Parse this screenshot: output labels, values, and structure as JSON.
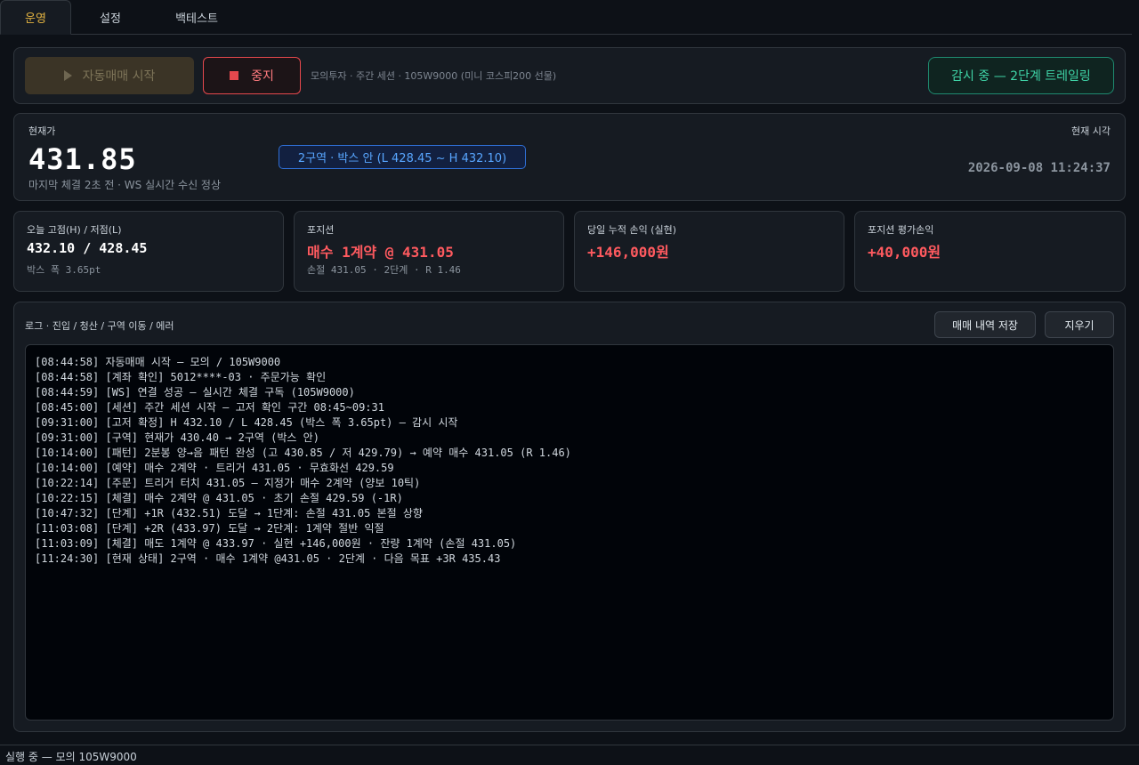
{
  "tabs": [
    {
      "label": "운영"
    },
    {
      "label": "설정"
    },
    {
      "label": "백테스트"
    }
  ],
  "controls": {
    "start_label": "자동매매 시작",
    "stop_label": "중지",
    "session_info": "모의투자 · 주간 세션 · 105W9000 (미니 코스피200 선물)",
    "status_label": "감시 중 — 2단계 트레일링"
  },
  "price": {
    "label": "현재가",
    "value": "431.85",
    "subinfo": "마지막 체결 2초 전 · WS 실시간 수신 정상",
    "zone_badge": "2구역 · 박스 안 (L 428.45 ~ H 432.10)",
    "clock_label": "현재 시각",
    "clock_value": "2026-09-08  11:24:37"
  },
  "cards": [
    {
      "title": "오늘 고점(H) / 저점(L)",
      "value": "432.10 / 428.45",
      "sub": "박스 폭 3.65pt",
      "color": "#ffffff"
    },
    {
      "title": "포지션",
      "value": "매수 1계약 @ 431.05",
      "sub": "손절 431.05 · 2단계 · R 1.46",
      "color": "#ff5a5f"
    },
    {
      "title": "당일 누적 손익 (실현)",
      "value": "+146,000원",
      "sub": "",
      "color": "#ff5a5f"
    },
    {
      "title": "포지션 평가손익",
      "value": "+40,000원",
      "sub": "",
      "color": "#ff5a5f"
    }
  ],
  "log": {
    "header": "로그 · 진입 / 청산 / 구역 이동 / 에러",
    "save_label": "매매 내역 저장",
    "clear_label": "지우기",
    "lines": [
      "[08:44:58] 자동매매 시작 — 모의 / 105W9000",
      "[08:44:58] [계좌 확인] 5012****-03 · 주문가능 확인",
      "[08:44:59] [WS] 연결 성공 — 실시간 체결 구독 (105W9000)",
      "[08:45:00] [세션] 주간 세션 시작 — 고저 확인 구간 08:45~09:31",
      "[09:31:00] [고저 확정] H 432.10 / L 428.45 (박스 폭 3.65pt) — 감시 시작",
      "[09:31:00] [구역] 현재가 430.40 → 2구역 (박스 안)",
      "[10:14:00] [패턴] 2분봉 양→음 패턴 완성 (고 430.85 / 저 429.79) → 예약 매수 431.05 (R 1.46)",
      "[10:14:00] [예약] 매수 2계약 · 트리거 431.05 · 무효화선 429.59",
      "[10:22:14] [주문] 트리거 터치 431.05 — 지정가 매수 2계약 (양보 10틱)",
      "[10:22:15] [체결] 매수 2계약 @ 431.05 · 초기 손절 429.59 (-1R)",
      "[10:47:32] [단계] +1R (432.51) 도달 → 1단계: 손절 431.05 본절 상향",
      "[11:03:08] [단계] +2R (433.97) 도달 → 2단계: 1계약 절반 익절",
      "[11:03:09] [체결] 매도 1계약 @ 433.97 · 실현 +146,000원 · 잔량 1계약 (손절 431.05)",
      "[11:24:30] [현재 상태] 2구역 · 매수 1계약 @431.05 · 2단계 · 다음 목표 +3R 435.43"
    ]
  },
  "statusbar": {
    "text": "실행 중 — 모의 105W9000"
  }
}
